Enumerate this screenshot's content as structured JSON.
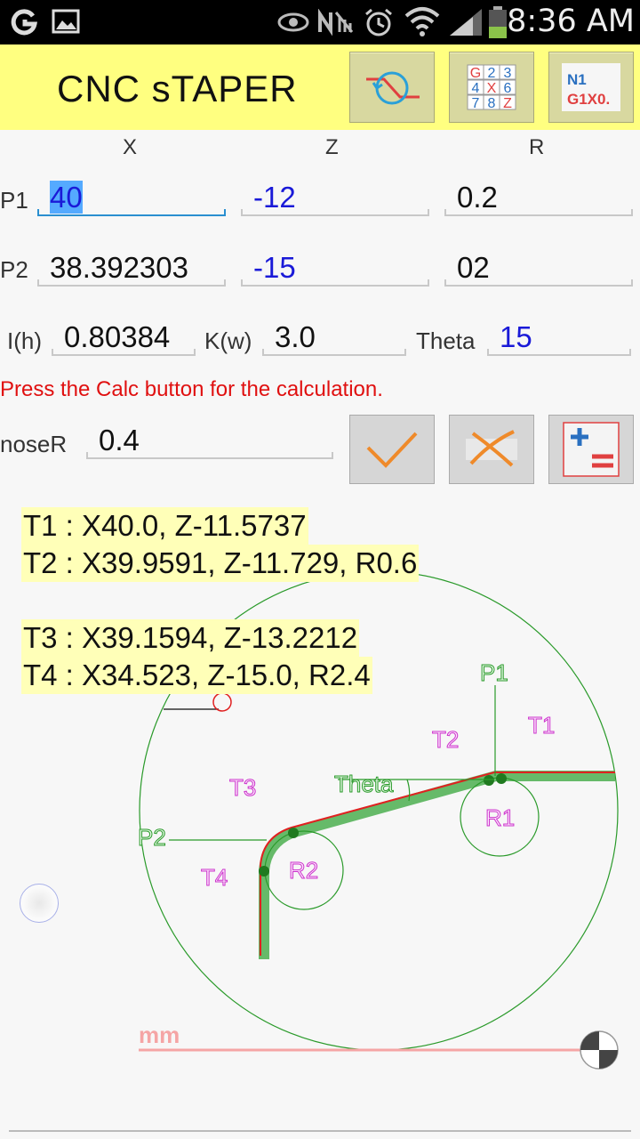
{
  "status_bar": {
    "time": "8:36 AM",
    "icons": [
      "g-app-icon",
      "image-icon",
      "eye-icon",
      "nfc-icon",
      "alarm-icon",
      "wifi-icon",
      "signal-icon",
      "battery-icon"
    ]
  },
  "app": {
    "title": "CNC sTAPER",
    "toolbar": {
      "taper_icon": "taper-cycle-icon",
      "keypad_icon": "keypad-grid-icon",
      "gcode_line1": "N1",
      "gcode_line2": "G1X0."
    }
  },
  "columns": {
    "x": "X",
    "z": "Z",
    "r": "R"
  },
  "p1": {
    "label": "P1",
    "x": "40",
    "z": "-12",
    "r": "0.2"
  },
  "p2": {
    "label": "P2",
    "x": "38.392303",
    "z": "-15",
    "r": "02"
  },
  "incremental": {
    "i_label": "I(h)",
    "i_value": "0.80384",
    "k_label": "K(w)",
    "k_value": "3.0",
    "theta_label": "Theta",
    "theta_value": "15"
  },
  "message": "Press the Calc button for the calculation.",
  "nose": {
    "label": "noseR",
    "value": "0.4"
  },
  "actions": {
    "calc_icon": "check-icon",
    "clear_icon": "clear-x-icon",
    "mode_icon": "plus-equals-icon"
  },
  "results": {
    "t1": "T1 : X40.0, Z-11.5737",
    "t2": "T2 : X39.9591, Z-11.729, R0.6",
    "t3": "T3 : X39.1594, Z-13.2212",
    "t4": "T4 : X34.523, Z-15.0, R2.4"
  },
  "diagram": {
    "p1": "P1",
    "p2": "P2",
    "t1": "T1",
    "t2": "T2",
    "t3": "T3",
    "t4": "T4",
    "r1": "R1",
    "r2": "R2",
    "theta": "Theta",
    "unit": "mm",
    "colors": {
      "profile": "#4caf50",
      "toolpath": "#e02020",
      "label_green": "#2aa02a",
      "label_magenta": "#cc33cc"
    }
  }
}
